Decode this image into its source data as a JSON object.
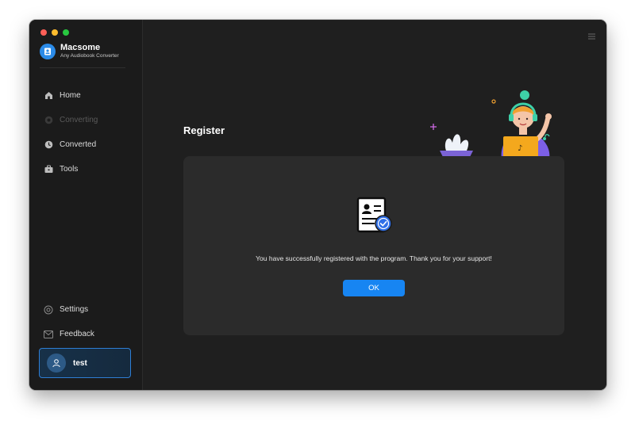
{
  "app": {
    "name": "Macsome",
    "subtitle": "Any Audiobook Converter"
  },
  "sidebar": {
    "items": [
      {
        "label": "Home",
        "icon": "home-icon"
      },
      {
        "label": "Converting",
        "icon": "converting-icon",
        "disabled": true
      },
      {
        "label": "Converted",
        "icon": "clock-icon"
      },
      {
        "label": "Tools",
        "icon": "toolbox-icon"
      }
    ],
    "bottom_items": [
      {
        "label": "Settings",
        "icon": "gear-icon"
      },
      {
        "label": "Feedback",
        "icon": "mail-icon"
      }
    ]
  },
  "user": {
    "name": "test",
    "icon": "user-icon"
  },
  "main": {
    "title": "Register",
    "message": "You have successfully registered with the program. Thank you for your support!",
    "ok_label": "OK"
  },
  "colors": {
    "accent": "#1785f2",
    "window_bg": "#1f1f1f",
    "sidebar_bg": "#1b1b1b",
    "panel_bg": "#2b2b2b",
    "user_card_border": "#2e7ed4"
  }
}
